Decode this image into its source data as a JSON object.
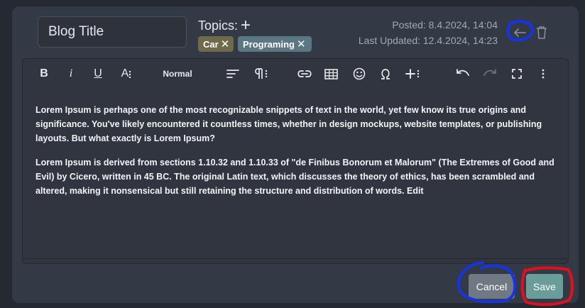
{
  "post": {
    "title_value": "Blog Title",
    "topics_label": "Topics:",
    "topics_add": "+",
    "topics": [
      {
        "label": "Car",
        "color": "#6e6a4b"
      },
      {
        "label": "Programing",
        "color": "#5b7784"
      }
    ],
    "remove_glyph": "✕",
    "posted": "Posted: 8.4.2024, 14:04",
    "last_updated": "Last Updated: 12.4.2024, 14:23"
  },
  "toolbar": {
    "bold": "B",
    "italic": "i",
    "underline": "U",
    "font_size": "A",
    "paragraph_style": "Normal"
  },
  "content": {
    "paragraphs": [
      "Lorem Ipsum is perhaps one of the most recognizable snippets of text in the world, yet few know its true origins and significance. You've likely encountered it countless times, whether in design mockups, website templates, or publishing layouts. But what exactly is Lorem Ipsum?",
      "Lorem Ipsum is derived from sections 1.10.32 and 1.10.33 of \"de Finibus Bonorum et Malorum\" (The Extremes of Good and Evil) by Cicero, written in 45 BC. The original Latin text, which discusses the theory of ethics, has been scrambled and altered, making it nonsensical but still retaining the structure and distribution of words. Edit"
    ]
  },
  "actions": {
    "cancel_label": "Cancel",
    "save_label": "Save"
  },
  "colors": {
    "card_bg": "#343a45",
    "cancel_bg": "#707884",
    "save_bg": "#6a9c99",
    "annotation_blue": "#1434e6",
    "annotation_red": "#e0101e"
  },
  "icons": [
    "back-arrow-icon",
    "trash-icon",
    "align-icon",
    "paragraph-icon",
    "link-icon",
    "table-icon",
    "emoji-icon",
    "omega-icon",
    "insert-icon",
    "undo-icon",
    "redo-icon",
    "fullscreen-icon",
    "more-icon"
  ]
}
